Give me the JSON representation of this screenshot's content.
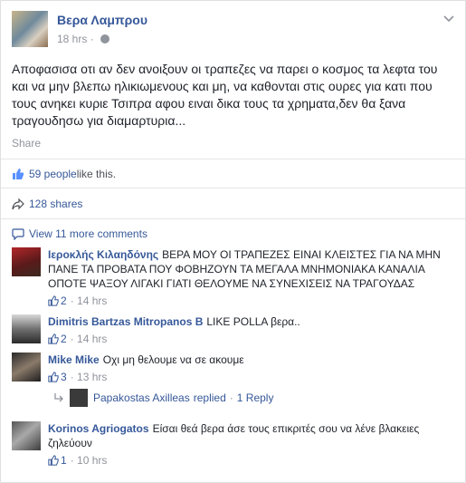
{
  "post": {
    "author": "Βερα Λαμπρου",
    "time": "18 hrs · ",
    "text": "Αποφασισα οτι αν δεν ανοιξουν οι τραπεζες να παρει ο κοσμος τα λεφτα του και να μην βλεπω ηλικιωμενους και μη, να καθονται στις ουρες για κατι που τους ανηκει κυριε Τσιπρα αφου ειναι δικα τους τα χρηματα,δεν θα ξανα τραγουδησω για διαμαρτυρια...",
    "share_label": "Share"
  },
  "stats": {
    "likes_count": "59 people",
    "likes_suffix": " like this.",
    "shares": "128 shares"
  },
  "view_more": "View 11 more comments",
  "comments": [
    {
      "name": "Ιεροκλής Κιλαηδόνης",
      "text": "ΒΕΡΑ ΜΟΥ ΟΙ ΤΡΑΠΕΖΕΣ ΕΙΝΑΙ ΚΛΕΙΣΤΕΣ ΓΙΑ ΝΑ ΜΗΝ ΠΑΝΕ ΤΑ ΠΡΟΒΑΤΑ ΠΟΥ ΦΟΒΗΖΟΥΝ ΤΑ ΜΕΓΑΛΑ ΜΝΗΜΟΝΙΑΚΑ ΚΑΝΑΛΙΑ ΟΠΟΤΕ ΨΑΞΟΥ ΛΙΓΑΚΙ ΓΙΑΤΙ ΘΕΛΟΥΜΕ ΝΑ ΣΥΝΕΧΙΣΕΙΣ ΝΑ ΤΡΑΓΟΥΔΑΣ",
      "likes": "2",
      "time": "14 hrs"
    },
    {
      "name": "Dimitris Bartzas Mitropanos B",
      "text": "LIKE POLLA βερα..",
      "likes": "2",
      "time": "14 hrs"
    },
    {
      "name": "Mike Mike",
      "text": "Οχι μη θελουμε να σε ακουμε",
      "likes": "3",
      "time": "13 hrs"
    },
    {
      "name": "Korinos Agriogatos",
      "text": "Είσαι θεά βερα άσε τους επικριτές σου να λένε βλακειες ζηλεύουν",
      "likes": "1",
      "time": "10 hrs"
    }
  ],
  "reply": {
    "name": "Papakostas Axilleas",
    "action": "replied",
    "sep": " · ",
    "count": "1 Reply"
  },
  "colors": {
    "link": "#365899",
    "meta": "#90949c",
    "text": "#1d2129"
  }
}
